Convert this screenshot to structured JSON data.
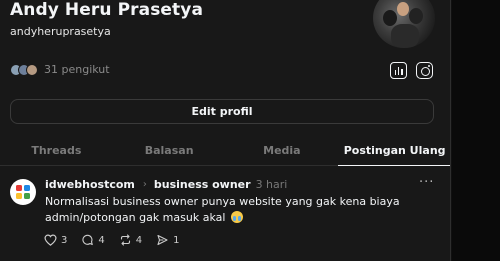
{
  "profile": {
    "name": "Andy Heru Prasetya",
    "handle": "andyheruprasetya",
    "followers_text": "31 pengikut",
    "edit_label": "Edit profil"
  },
  "tabs": [
    {
      "label": "Threads",
      "active": false
    },
    {
      "label": "Balasan",
      "active": false
    },
    {
      "label": "Media",
      "active": false
    },
    {
      "label": "Postingan Ulang",
      "active": true
    }
  ],
  "post": {
    "author": "idwebhostcom",
    "topic": "business owner",
    "time": "3 hari",
    "text": "Normalisasi business owner punya website yang gak kena biaya admin/potongan gak masuk akal",
    "emoji": "crying-face-icon",
    "likes": "3",
    "replies": "4",
    "reposts": "4",
    "shares": "1",
    "more": "···"
  },
  "colors": {
    "background": "#101010",
    "panel": "#181818",
    "text": "#f3f5f7",
    "muted": "#7a7a7a"
  }
}
